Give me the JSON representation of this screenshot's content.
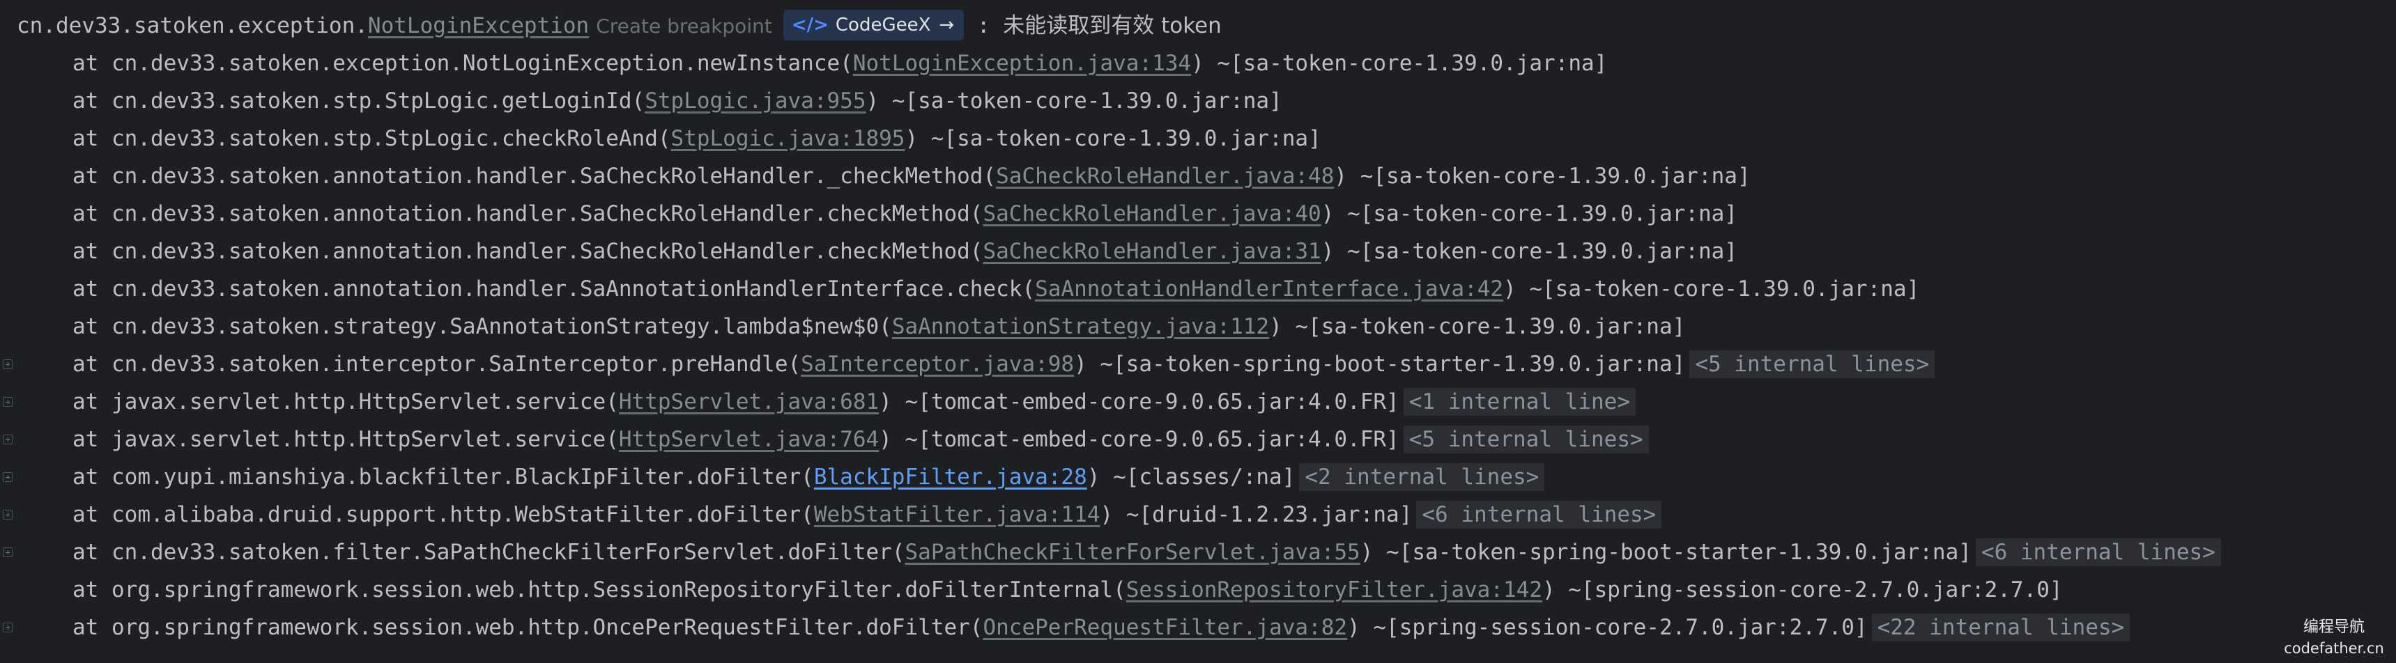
{
  "header": {
    "prefix": "cn.dev33.satoken.exception.",
    "exception_link": "NotLoginException",
    "create_breakpoint": "Create breakpoint",
    "codegeex_label": "CodeGeeX",
    "codegeex_arrow": "→",
    "separator": " : ",
    "message": "未能读取到有效 token"
  },
  "frames": [
    {
      "expandable": false,
      "text": "at cn.dev33.satoken.exception.NotLoginException.newInstance(",
      "link": "NotLoginException.java:134",
      "link_style": "muted",
      "suffix": ") ~[sa-token-core-1.39.0.jar:na]",
      "internal": ""
    },
    {
      "expandable": false,
      "text": "at cn.dev33.satoken.stp.StpLogic.getLoginId(",
      "link": "StpLogic.java:955",
      "link_style": "muted",
      "suffix": ") ~[sa-token-core-1.39.0.jar:na]",
      "internal": ""
    },
    {
      "expandable": false,
      "text": "at cn.dev33.satoken.stp.StpLogic.checkRoleAnd(",
      "link": "StpLogic.java:1895",
      "link_style": "muted",
      "suffix": ") ~[sa-token-core-1.39.0.jar:na]",
      "internal": ""
    },
    {
      "expandable": false,
      "text": "at cn.dev33.satoken.annotation.handler.SaCheckRoleHandler._checkMethod(",
      "link": "SaCheckRoleHandler.java:48",
      "link_style": "muted",
      "suffix": ") ~[sa-token-core-1.39.0.jar:na]",
      "internal": ""
    },
    {
      "expandable": false,
      "text": "at cn.dev33.satoken.annotation.handler.SaCheckRoleHandler.checkMethod(",
      "link": "SaCheckRoleHandler.java:40",
      "link_style": "muted",
      "suffix": ") ~[sa-token-core-1.39.0.jar:na]",
      "internal": ""
    },
    {
      "expandable": false,
      "text": "at cn.dev33.satoken.annotation.handler.SaCheckRoleHandler.checkMethod(",
      "link": "SaCheckRoleHandler.java:31",
      "link_style": "muted",
      "suffix": ") ~[sa-token-core-1.39.0.jar:na]",
      "internal": ""
    },
    {
      "expandable": false,
      "text": "at cn.dev33.satoken.annotation.handler.SaAnnotationHandlerInterface.check(",
      "link": "SaAnnotationHandlerInterface.java:42",
      "link_style": "muted",
      "suffix": ") ~[sa-token-core-1.39.0.jar:na]",
      "internal": ""
    },
    {
      "expandable": false,
      "text": "at cn.dev33.satoken.strategy.SaAnnotationStrategy.lambda$new$0(",
      "link": "SaAnnotationStrategy.java:112",
      "link_style": "muted",
      "suffix": ") ~[sa-token-core-1.39.0.jar:na]",
      "internal": ""
    },
    {
      "expandable": true,
      "text": "at cn.dev33.satoken.interceptor.SaInterceptor.preHandle(",
      "link": "SaInterceptor.java:98",
      "link_style": "muted",
      "suffix": ") ~[sa-token-spring-boot-starter-1.39.0.jar:na]",
      "internal": "<5 internal lines>"
    },
    {
      "expandable": true,
      "text": "at javax.servlet.http.HttpServlet.service(",
      "link": "HttpServlet.java:681",
      "link_style": "muted",
      "suffix": ") ~[tomcat-embed-core-9.0.65.jar:4.0.FR]",
      "internal": "<1 internal line>"
    },
    {
      "expandable": true,
      "text": "at javax.servlet.http.HttpServlet.service(",
      "link": "HttpServlet.java:764",
      "link_style": "muted",
      "suffix": ") ~[tomcat-embed-core-9.0.65.jar:4.0.FR]",
      "internal": "<5 internal lines>"
    },
    {
      "expandable": true,
      "text": "at com.yupi.mianshiya.blackfilter.BlackIpFilter.doFilter(",
      "link": "BlackIpFilter.java:28",
      "link_style": "blue",
      "suffix": ") ~[classes/:na]",
      "internal": "<2 internal lines>"
    },
    {
      "expandable": true,
      "text": "at com.alibaba.druid.support.http.WebStatFilter.doFilter(",
      "link": "WebStatFilter.java:114",
      "link_style": "muted",
      "suffix": ") ~[druid-1.2.23.jar:na]",
      "internal": "<6 internal lines>"
    },
    {
      "expandable": true,
      "text": "at cn.dev33.satoken.filter.SaPathCheckFilterForServlet.doFilter(",
      "link": "SaPathCheckFilterForServlet.java:55",
      "link_style": "muted",
      "suffix": ") ~[sa-token-spring-boot-starter-1.39.0.jar:na]",
      "internal": "<6 internal lines>"
    },
    {
      "expandable": false,
      "text": "at org.springframework.session.web.http.SessionRepositoryFilter.doFilterInternal(",
      "link": "SessionRepositoryFilter.java:142",
      "link_style": "muted",
      "suffix": ") ~[spring-session-core-2.7.0.jar:2.7.0]",
      "internal": ""
    },
    {
      "expandable": true,
      "text": "at org.springframework.session.web.http.OncePerRequestFilter.doFilter(",
      "link": "OncePerRequestFilter.java:82",
      "link_style": "muted",
      "suffix": ") ~[spring-session-core-2.7.0.jar:2.7.0]",
      "internal": "<22 internal lines>"
    }
  ],
  "watermark": {
    "line1": "编程导航",
    "line2": "codefather.cn"
  },
  "colors": {
    "background": "#1e1f22",
    "text": "#bcbec4",
    "muted_link": "#878a91",
    "blue_link": "#5f9ff5",
    "internal_badge_bg": "#2c2e33",
    "codegeex_bg": "#27344d",
    "codegeex_icon": "#4f8cff"
  },
  "icons": {
    "codegeex": "codegeex-icon",
    "expand": "expand-plus-icon"
  }
}
